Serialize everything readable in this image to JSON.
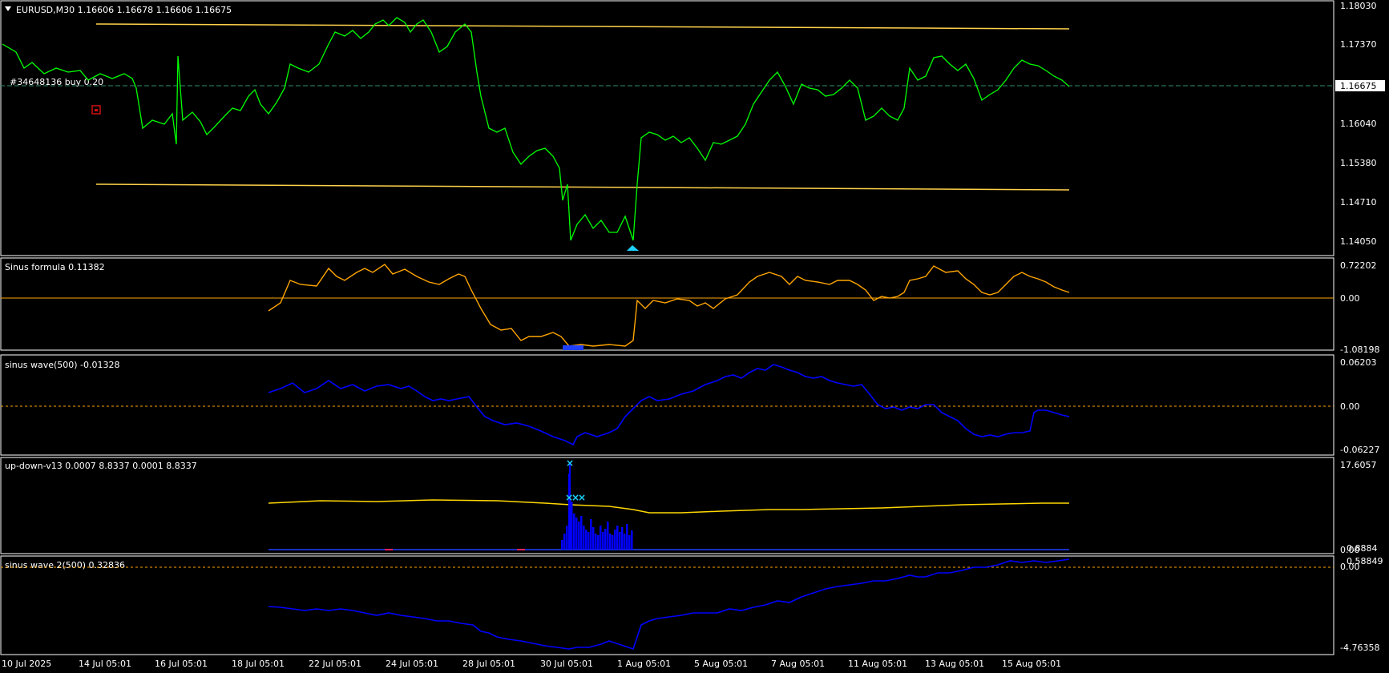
{
  "colors": {
    "background": "#000000",
    "frame": "#ffffff",
    "price_line": "#00ff00",
    "channel": "#ffd24a",
    "sinus_formula": "#ffa500",
    "sinus_wave": "#0000ff",
    "updown_band": "#ffd700",
    "updown_hist": "#0000ff",
    "marker": "#1fd2ff",
    "current_price_bg": "#ffffff",
    "order_line": "#2f8f6a"
  },
  "main": {
    "title": "EURUSD,M30  1.16606 1.16678 1.16606 1.16675",
    "dropdown_icon": "triangle-down-icon",
    "order_label": "#34648136 buy 0.20",
    "current_price": "1.16675",
    "price_ticks": [
      "1.18030",
      "1.17370",
      "1.16040",
      "1.15380",
      "1.14710",
      "1.14050"
    ]
  },
  "panes": [
    {
      "label": "Sinus formula 0.11382",
      "ticks": [
        "0.72202",
        "0.00",
        "-1.08198"
      ]
    },
    {
      "label": "sinus wave(500) -0.01328",
      "ticks": [
        "0.06203",
        "0.00",
        "-0.06227"
      ]
    },
    {
      "label": "up-down-v13 0.0007 8.8337 0.0001 8.8337",
      "ticks": [
        "17.6057",
        "0.8884",
        "0.00"
      ]
    },
    {
      "label": "sinus wave 2(500) 0.32836",
      "ticks": [
        "0.58849",
        "0.00",
        "-4.76358"
      ]
    }
  ],
  "time_axis": [
    "10 Jul 2025",
    "14 Jul 05:01",
    "16 Jul 05:01",
    "18 Jul 05:01",
    "22 Jul 05:01",
    "24 Jul 05:01",
    "28 Jul 05:01",
    "30 Jul 05:01",
    "1 Aug 05:01",
    "5 Aug 05:01",
    "7 Aug 05:01",
    "11 Aug 05:01",
    "13 Aug 05:01",
    "15 Aug 05:01"
  ]
}
